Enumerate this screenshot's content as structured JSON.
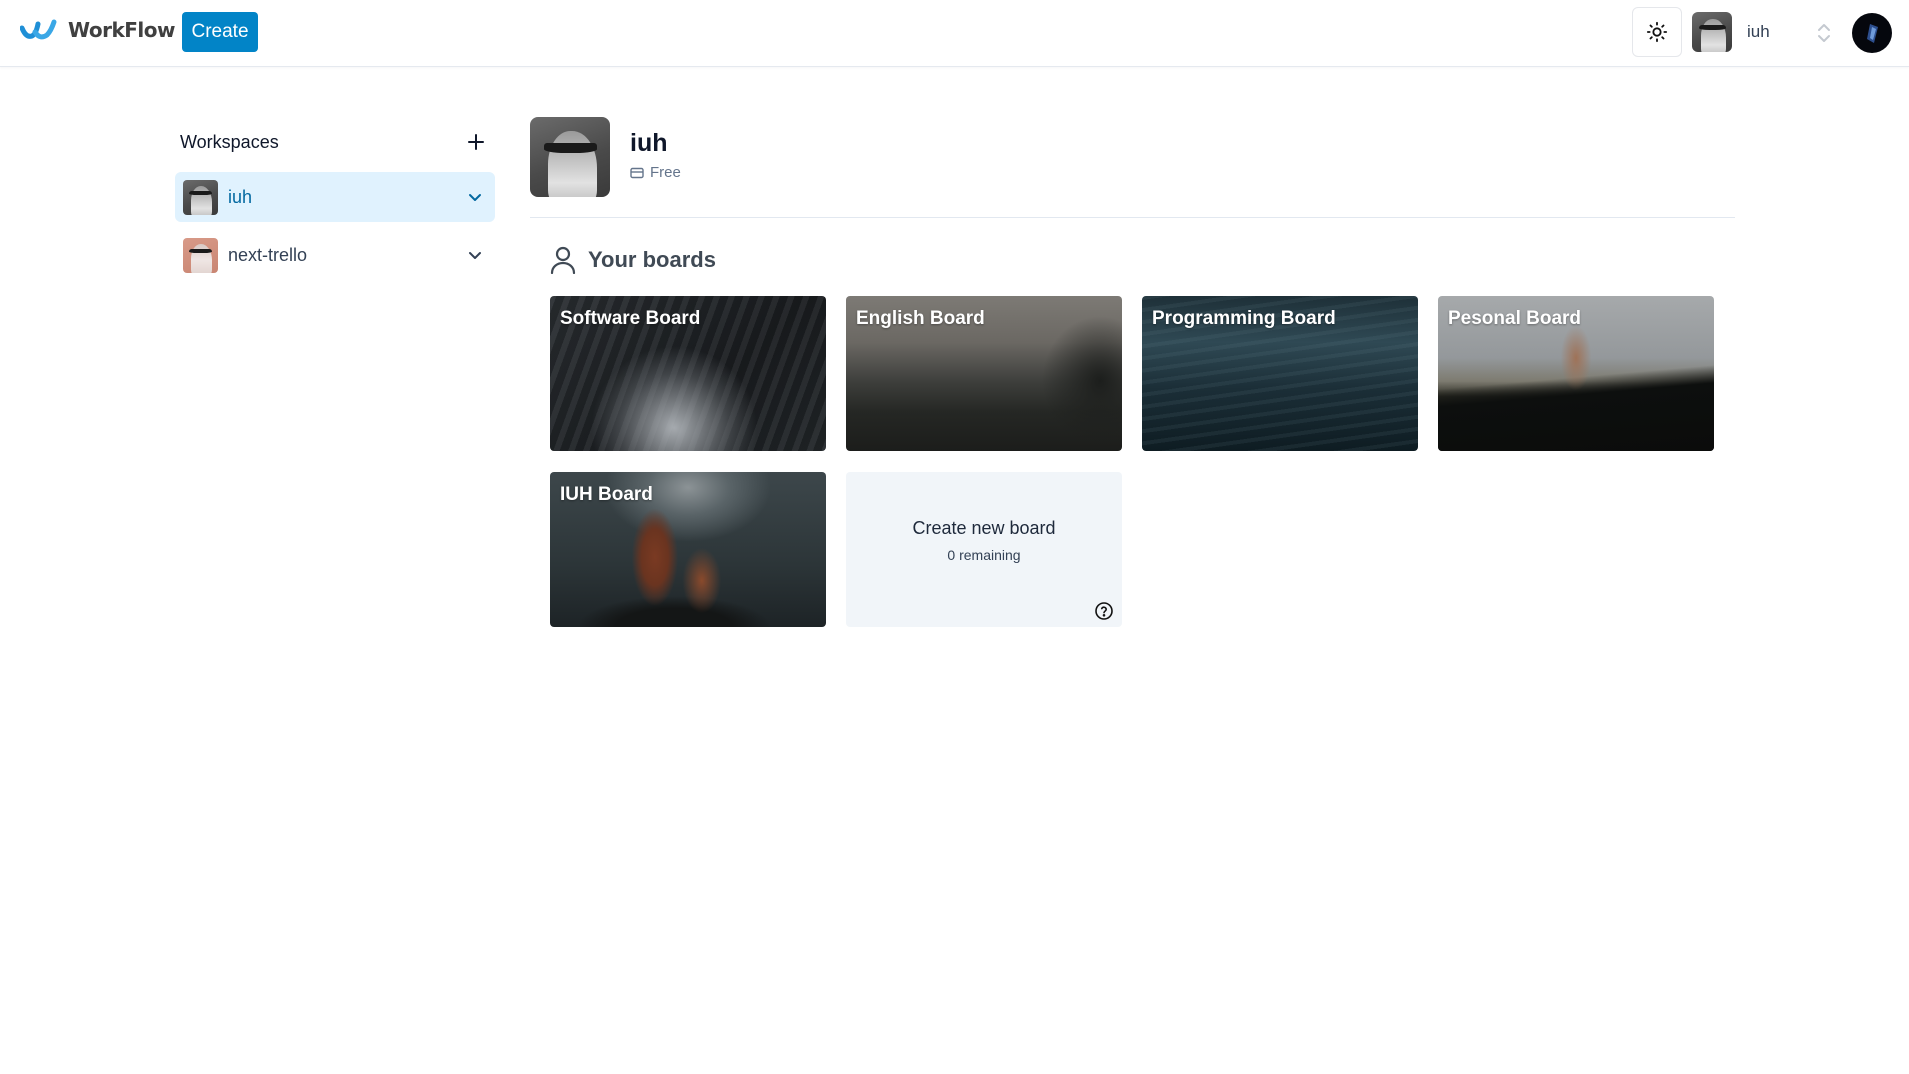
{
  "header": {
    "logo_text": "WorkFlow",
    "create_label": "Create",
    "theme_icon": "sun-icon",
    "org_switcher": {
      "name": "iuh",
      "icon": "chevrons-up-down-icon"
    },
    "user_avatar": "user-avatar"
  },
  "sidebar": {
    "title": "Workspaces",
    "add_icon": "plus-icon",
    "workspaces": [
      {
        "label": "iuh",
        "active": true,
        "icon": "chevron-down-icon"
      },
      {
        "label": "next-trello",
        "active": false,
        "icon": "chevron-down-icon"
      }
    ]
  },
  "main": {
    "org": {
      "name": "iuh",
      "plan": "Free",
      "plan_icon": "credit-card-icon"
    },
    "boards_title": "Your boards",
    "boards_icon": "user-icon",
    "boards": [
      {
        "title": "Software Board"
      },
      {
        "title": "English Board"
      },
      {
        "title": "Programming Board"
      },
      {
        "title": "Pesonal Board"
      },
      {
        "title": "IUH Board"
      }
    ],
    "create_board": {
      "label": "Create new board",
      "remaining": "0 remaining",
      "help_icon": "help-circle-icon"
    }
  },
  "colors": {
    "accent": "#0284c7",
    "active_item_bg": "#e0f2fe",
    "active_item_text": "#0369a1",
    "create_card_bg": "#f1f5f9"
  }
}
